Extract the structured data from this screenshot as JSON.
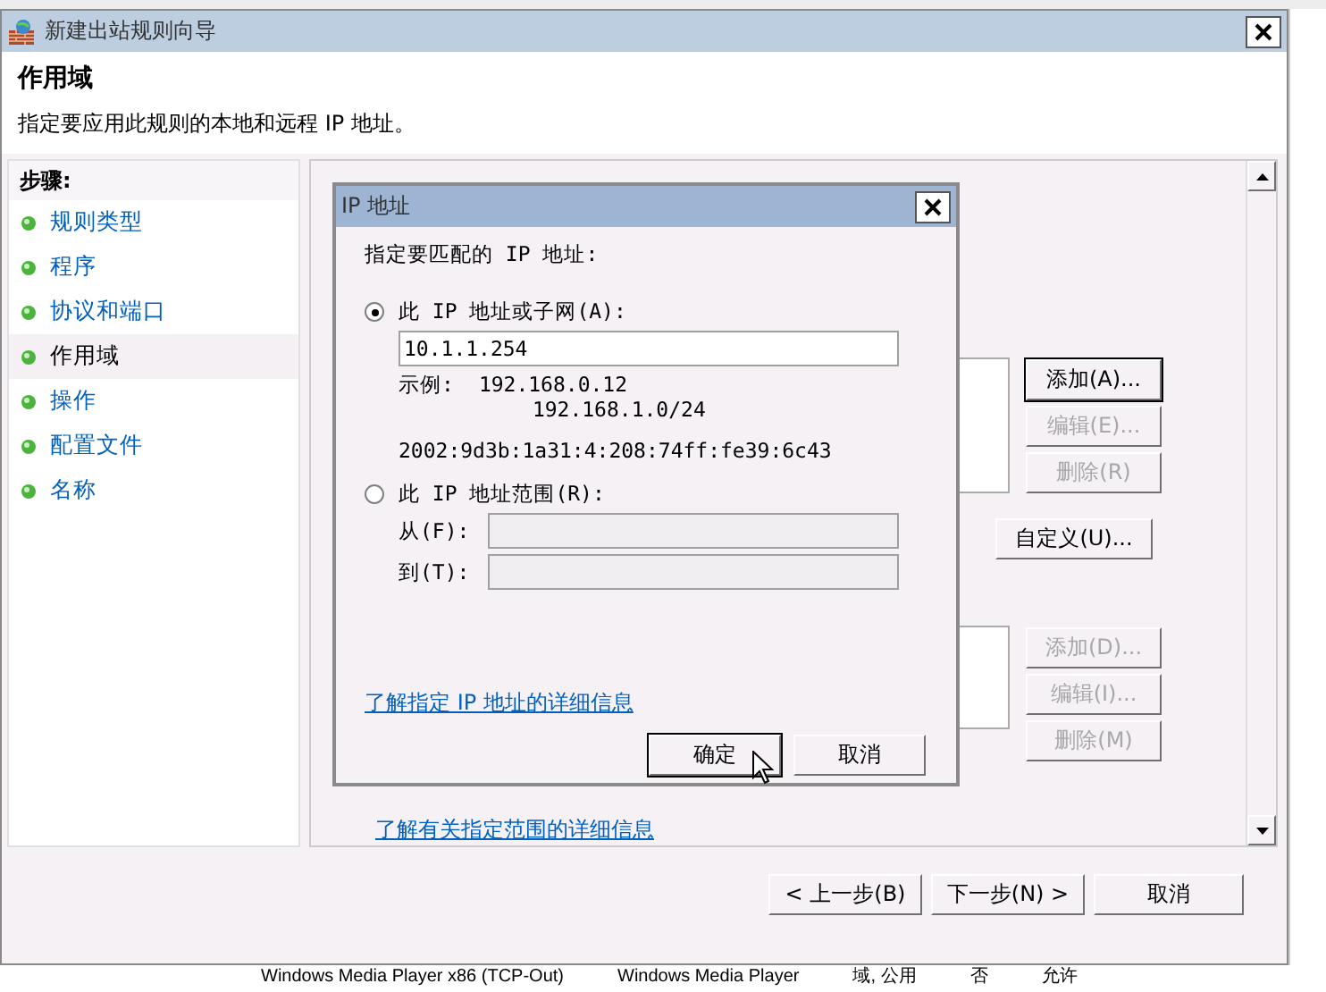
{
  "window": {
    "title": "新建出站规则向导"
  },
  "header": {
    "title": "作用域",
    "description": "指定要应用此规则的本地和远程 IP 地址。"
  },
  "steps": {
    "heading": "步骤:",
    "items": [
      {
        "label": "规则类型",
        "selected": false
      },
      {
        "label": "程序",
        "selected": false
      },
      {
        "label": "协议和端口",
        "selected": false
      },
      {
        "label": "作用域",
        "selected": true
      },
      {
        "label": "操作",
        "selected": false
      },
      {
        "label": "配置文件",
        "selected": false
      },
      {
        "label": "名称",
        "selected": false
      }
    ]
  },
  "content": {
    "local_buttons": [
      {
        "label": "添加(A)...",
        "disabled": false,
        "default": true
      },
      {
        "label": "编辑(E)...",
        "disabled": true,
        "default": false
      },
      {
        "label": "删除(R)",
        "disabled": true,
        "default": false
      }
    ],
    "customize_button": "自定义(U)...",
    "remote_buttons": [
      {
        "label": "添加(D)...",
        "disabled": true,
        "default": false
      },
      {
        "label": "编辑(I)...",
        "disabled": true,
        "default": false
      },
      {
        "label": "删除(M)",
        "disabled": true,
        "default": false
      }
    ],
    "link": "了解有关指定范围的详细信息"
  },
  "nav_buttons": [
    {
      "label": "< 上一步(B)"
    },
    {
      "label": "下一步(N) >"
    },
    {
      "label": "取消"
    }
  ],
  "ip_dialog": {
    "title": "IP 地址",
    "prompt": "指定要匹配的 IP 地址:",
    "options": [
      {
        "label": "此 IP 地址或子网(A):",
        "selected": true
      },
      {
        "label": "此 IP 地址范围(R):",
        "selected": false
      }
    ],
    "address_value": "10.1.1.254",
    "example_label": "示例:",
    "examples": [
      "192.168.0.12",
      "192.168.1.0/24",
      "2002:9d3b:1a31:4:208:74ff:fe39:6c43"
    ],
    "from_label": "从(F):",
    "to_label": "到(T):",
    "link": "了解指定 IP 地址的详细信息",
    "buttons": [
      {
        "label": "确定",
        "default": true
      },
      {
        "label": "取消",
        "default": false
      }
    ]
  },
  "background_row": {
    "cells": [
      "Windows Media Player x86 (TCP-Out)",
      "Windows Media Player",
      "域, 公用",
      "否",
      "允许"
    ]
  }
}
